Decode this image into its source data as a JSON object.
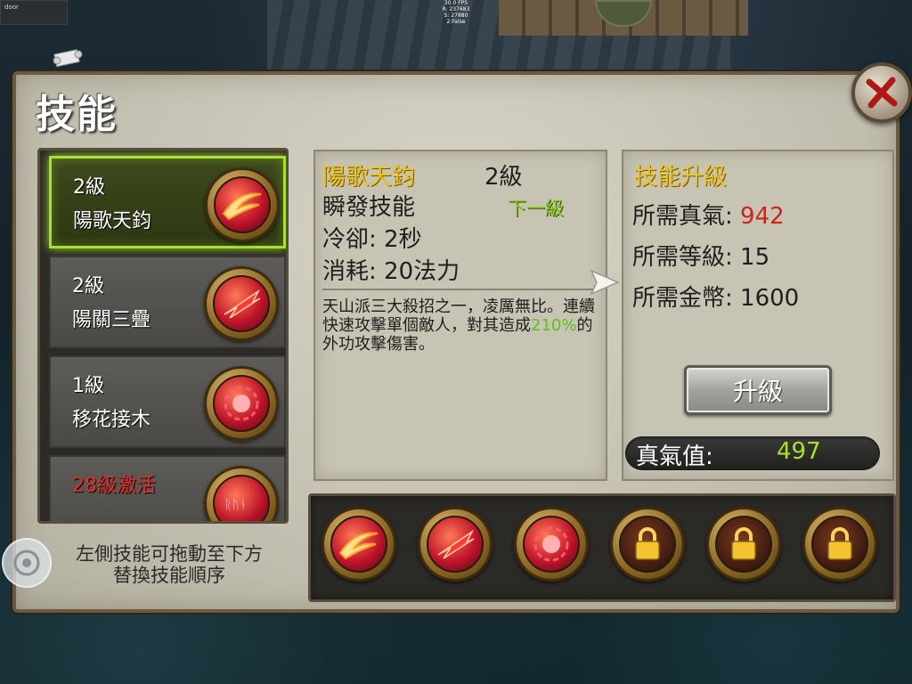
{
  "hud": {
    "door_label": "door",
    "fps_lines": [
      "30.0 FPS",
      "R: 237683",
      "S: 27880",
      "2:False"
    ]
  },
  "panel": {
    "title": "技能"
  },
  "skill_list": [
    {
      "level": "2級",
      "name": "陽歌天鈞",
      "selected": true,
      "icon": "flame-slash-icon"
    },
    {
      "level": "2級",
      "name": "陽關三疊",
      "selected": false,
      "icon": "red-slash-icon"
    },
    {
      "level": "1級",
      "name": "移花接木",
      "selected": false,
      "icon": "crimson-burst-icon"
    },
    {
      "unlock_text": "28級激活",
      "selected": false,
      "icon": "rune-orb-icon"
    }
  ],
  "hint": {
    "line1": "左側技能可拖動至下方",
    "line2": "替換技能順序"
  },
  "detail": {
    "name": "陽歌天鈞",
    "level": "2級",
    "type": "瞬發技能",
    "next_level": "下一級",
    "cooldown": "冷卻: 2秒",
    "cost": "消耗: 20法力",
    "desc_part1": "天山派三大殺招之一，凌厲無比。連續快速攻擊單個敵人，對其造成",
    "desc_highlight": "210%",
    "desc_part2": "的外功攻擊傷害。"
  },
  "upgrade": {
    "title": "技能升級",
    "qi_label": "所需真氣: ",
    "qi_value": "942",
    "level_label": "所需等級: 15",
    "gold_label": "所需金幣: 1600",
    "button_label": "升級",
    "current_qi_label": "真氣值:",
    "current_qi_value": "497"
  },
  "hotbar": [
    {
      "icon": "flame-slash-icon",
      "locked": false
    },
    {
      "icon": "red-slash-icon",
      "locked": false
    },
    {
      "icon": "crimson-burst-icon",
      "locked": false
    },
    {
      "icon": "padlock-icon",
      "locked": true
    },
    {
      "icon": "padlock-icon",
      "locked": true
    },
    {
      "icon": "padlock-icon",
      "locked": true
    }
  ],
  "colors": {
    "gold_title": "#f0c419",
    "highlight_green": "#a6e22e",
    "cost_red": "#d0201c",
    "locked_red": "#e0302a"
  }
}
